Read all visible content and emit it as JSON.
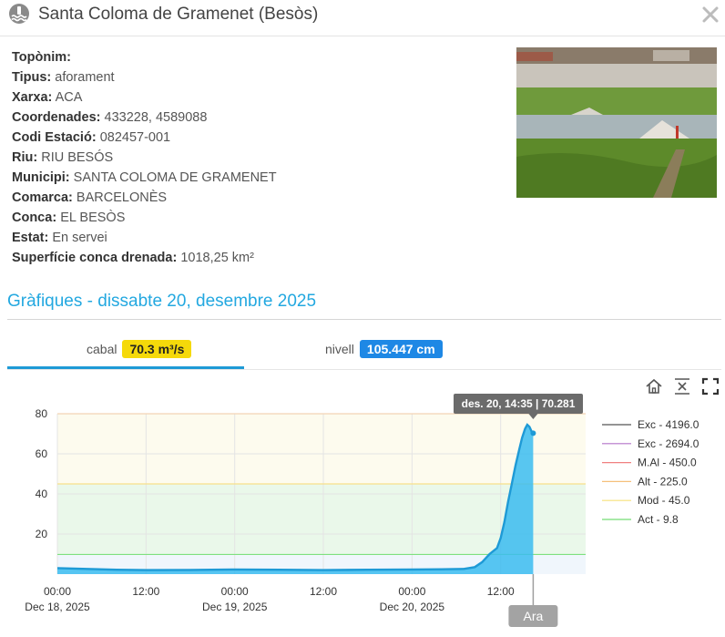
{
  "header": {
    "title": "Santa Coloma de Gramenet (Besòs)",
    "station_icon": "gauge-station-icon",
    "close_icon": "close-icon"
  },
  "info": {
    "rows": [
      {
        "key": "Topònim:",
        "value": ""
      },
      {
        "key": "Tipus:",
        "value": "aforament"
      },
      {
        "key": "Xarxa:",
        "value": "ACA"
      },
      {
        "key": "Coordenades:",
        "value": "433228, 4589088"
      },
      {
        "key": "Codi Estació:",
        "value": "082457-001"
      },
      {
        "key": "Riu:",
        "value": "RIU BESÓS"
      },
      {
        "key": "Municipi:",
        "value": "SANTA COLOMA DE GRAMENET"
      },
      {
        "key": "Comarca:",
        "value": "BARCELONÈS"
      },
      {
        "key": "Conca:",
        "value": "EL BESÒS"
      },
      {
        "key": "Estat:",
        "value": "En servei"
      },
      {
        "key": "Superfície conca drenada:",
        "value": "1018,25 km²"
      }
    ]
  },
  "section": {
    "title": "Gràfiques - dissabte 20, desembre 2025"
  },
  "tabs": {
    "cabal": {
      "label": "cabal",
      "value": "70.3 m³/s"
    },
    "nivell": {
      "label": "nivell",
      "value": "105.447 cm"
    }
  },
  "toolbar": {
    "home_icon": "home-icon",
    "zoom_icon": "fit-vertical-icon",
    "fullscreen_icon": "fullscreen-icon"
  },
  "colors": {
    "accent": "#23a8e0",
    "cabal_badge": "#f5d90a",
    "nivell_badge": "#1e88e5",
    "series": "#1e9ad6"
  },
  "chart_data": {
    "type": "area",
    "x_tick_labels": [
      [
        "00:00",
        "Dec 18, 2025"
      ],
      [
        "12:00",
        ""
      ],
      [
        "00:00",
        "Dec 19, 2025"
      ],
      [
        "12:00",
        ""
      ],
      [
        "00:00",
        "Dec 20, 2025"
      ],
      [
        "12:00",
        ""
      ]
    ],
    "x_hours": [
      0,
      12,
      24,
      36,
      48,
      60
    ],
    "xlim_hours": [
      0,
      71.5
    ],
    "ylim": [
      0,
      80
    ],
    "y_ticks": [
      20,
      40,
      60,
      80
    ],
    "series": [
      {
        "name": "cabal",
        "points": [
          [
            0,
            3.0
          ],
          [
            4,
            2.6
          ],
          [
            8,
            2.2
          ],
          [
            12,
            2.0
          ],
          [
            18,
            2.1
          ],
          [
            24,
            2.3
          ],
          [
            30,
            2.2
          ],
          [
            36,
            2.0
          ],
          [
            42,
            2.2
          ],
          [
            48,
            2.3
          ],
          [
            52,
            2.4
          ],
          [
            55,
            2.6
          ],
          [
            56.5,
            3.5
          ],
          [
            57.5,
            6
          ],
          [
            58.5,
            10
          ],
          [
            59.5,
            13
          ],
          [
            60,
            18
          ],
          [
            60.5,
            26
          ],
          [
            61,
            36
          ],
          [
            61.5,
            45
          ],
          [
            62,
            54
          ],
          [
            62.5,
            62
          ],
          [
            62.9,
            68
          ],
          [
            63.3,
            72.5
          ],
          [
            63.6,
            74.5
          ],
          [
            63.9,
            73.5
          ],
          [
            64.2,
            71
          ],
          [
            64.4,
            70.3
          ]
        ]
      }
    ],
    "threshold_bands": [
      {
        "from": 0,
        "to": 9.8,
        "color": "#f0f6fc"
      },
      {
        "from": 9.8,
        "to": 45,
        "color": "#eaf8ea"
      },
      {
        "from": 45,
        "to": 80,
        "color": "#fdfbee"
      }
    ],
    "threshold_lines": [
      {
        "value": 9.8,
        "color": "#7fe07f"
      },
      {
        "value": 45,
        "color": "#f7e08a"
      },
      {
        "value": 80,
        "color": "#f3d4b4"
      }
    ],
    "legend": [
      {
        "label": "Exc - 4196.0",
        "color": "#555555"
      },
      {
        "label": "Exc - 2694.0",
        "color": "#b373c9"
      },
      {
        "label": "M.Al - 450.0",
        "color": "#f08080"
      },
      {
        "label": "Alt - 225.0",
        "color": "#f5c07a"
      },
      {
        "label": "Mod - 45.0",
        "color": "#f6e07a"
      },
      {
        "label": "Act - 9.8",
        "color": "#74de74"
      }
    ],
    "legend_position": "right",
    "tooltip": "des. 20, 14:35 | 70.281",
    "now_label": "Ara",
    "now_hours": 64.4
  }
}
